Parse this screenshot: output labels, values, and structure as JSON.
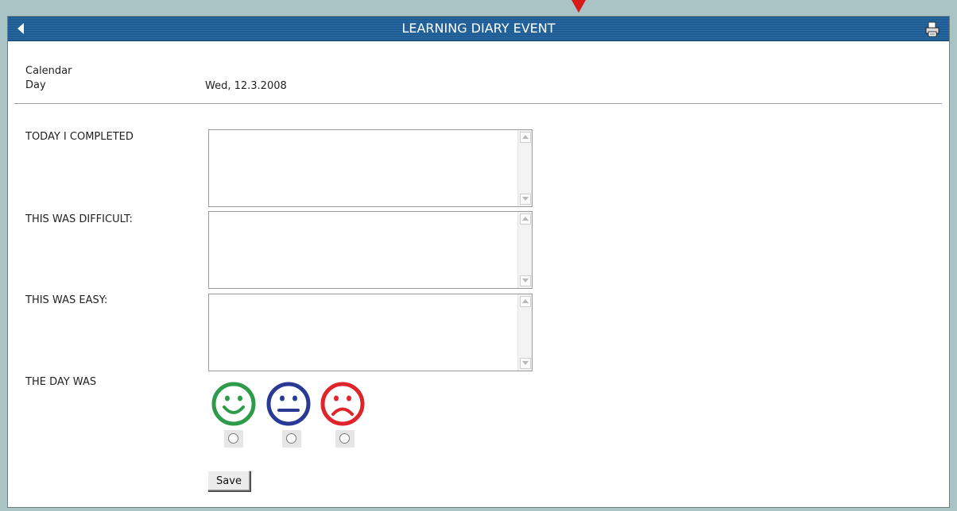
{
  "header": {
    "title": "LEARNING DIARY EVENT",
    "back_icon": "back-arrow-icon",
    "print_icon": "printer-icon"
  },
  "calendar_day": {
    "label": "Calendar\nDay",
    "value": "Wed, 12.3.2008"
  },
  "fields": [
    {
      "label": "TODAY I COMPLETED",
      "value": ""
    },
    {
      "label": "THIS WAS DIFFICULT:",
      "value": ""
    },
    {
      "label": "THIS WAS EASY:",
      "value": ""
    }
  ],
  "day_rating": {
    "label": "THE DAY WAS",
    "options": [
      {
        "icon": "happy-face-icon",
        "color": "#2e9b4b"
      },
      {
        "icon": "neutral-face-icon",
        "color": "#283a94"
      },
      {
        "icon": "sad-face-icon",
        "color": "#e0252a"
      }
    ],
    "selected": null
  },
  "buttons": {
    "save_label": "Save"
  },
  "colors": {
    "titlebar": "#1e5c93",
    "marker": "#d81a1a",
    "page_background": "#aac4c6"
  }
}
